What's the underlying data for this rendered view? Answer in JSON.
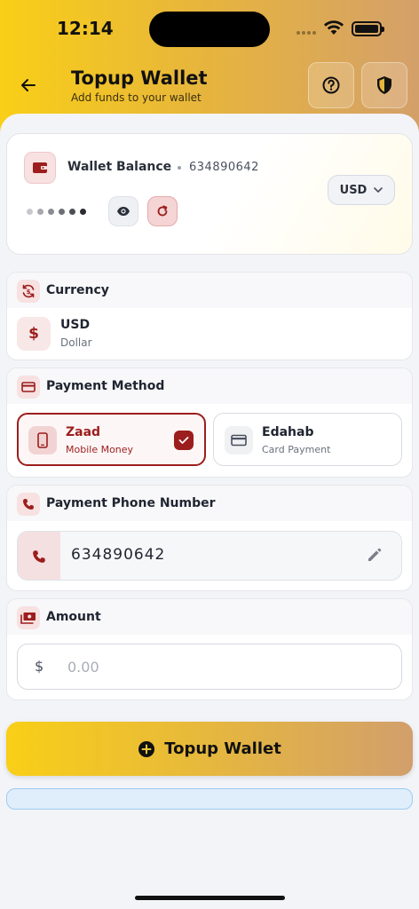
{
  "status_bar": {
    "time": "12:14"
  },
  "header": {
    "title": "Topup Wallet",
    "subtitle": "Add funds to your wallet",
    "icons": {
      "back": "arrow-left-icon",
      "help": "help-circle-icon",
      "shield": "shield-icon"
    }
  },
  "balance_card": {
    "label": "Wallet Balance",
    "account_number": "634890642",
    "currency_selector": "USD",
    "masked_dot_colors": [
      "#c6c8cd",
      "#a7a9ae",
      "#8a8c91",
      "#6c6e73",
      "#4c4e53",
      "#2a2c30"
    ]
  },
  "currency_section": {
    "title": "Currency",
    "symbol": "$",
    "code": "USD",
    "name": "Dollar"
  },
  "payment_section": {
    "title": "Payment Method",
    "methods": [
      {
        "name": "Zaad",
        "subtitle": "Mobile Money",
        "selected": true
      },
      {
        "name": "Edahab",
        "subtitle": "Card Payment",
        "selected": false
      }
    ]
  },
  "phone_section": {
    "title": "Payment Phone Number",
    "value": "634890642"
  },
  "amount_section": {
    "title": "Amount",
    "symbol": "$",
    "placeholder": "0.00"
  },
  "topup_button": {
    "label": "Topup Wallet"
  },
  "colors": {
    "brand_red": "#9c1d1d",
    "gradient_start": "#f9cf17",
    "gradient_end": "#d4a06a"
  }
}
